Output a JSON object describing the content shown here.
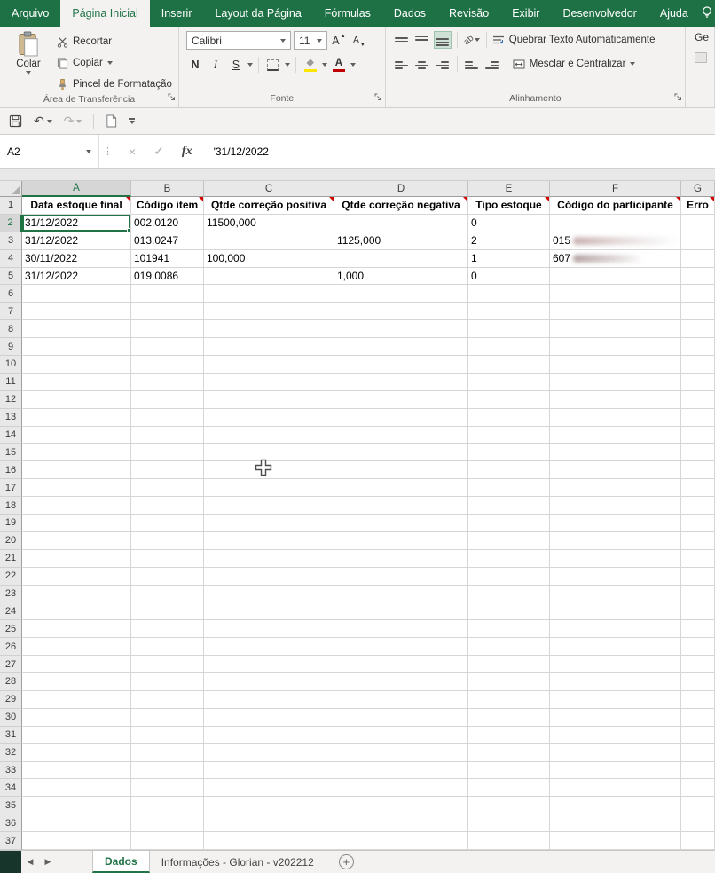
{
  "colors": {
    "accent_green": "#217346",
    "ribbon_green": "#1e7145",
    "ribbon_bg": "#f3f2f1",
    "grid_line": "#d6d6d6",
    "header_bg": "#e8e8e8",
    "selected_header_bg": "#d6d6d6",
    "comment_red": "#d40000",
    "fill_yellow": "#ffe600",
    "font_color_red": "#c00000"
  },
  "ribbon_tabs": [
    {
      "label": "Arquivo",
      "active": false
    },
    {
      "label": "Página Inicial",
      "active": true
    },
    {
      "label": "Inserir",
      "active": false
    },
    {
      "label": "Layout da Página",
      "active": false
    },
    {
      "label": "Fórmulas",
      "active": false
    },
    {
      "label": "Dados",
      "active": false
    },
    {
      "label": "Revisão",
      "active": false
    },
    {
      "label": "Exibir",
      "active": false
    },
    {
      "label": "Desenvolvedor",
      "active": false
    },
    {
      "label": "Ajuda",
      "active": false
    }
  ],
  "clipboard_group": {
    "paste": "Colar",
    "cut": "Recortar",
    "copy": "Copiar",
    "format_painter": "Pincel de Formatação",
    "label": "Área de Transferência"
  },
  "font_group": {
    "font_name": "Calibri",
    "font_size": "11",
    "bold": "N",
    "italic": "I",
    "underline": "S",
    "label": "Fonte"
  },
  "alignment_group": {
    "wrap_text": "Quebrar Texto Automaticamente",
    "merge_center": "Mesclar e Centralizar",
    "label": "Alinhamento"
  },
  "number_group_partial": "Ge",
  "formula_bar": {
    "name_box": "A2",
    "fx_label": "fx",
    "formula": "'31/12/2022"
  },
  "icons": {
    "cancel": "×",
    "enter": "✓",
    "undo": "↶",
    "redo": "↷",
    "nav_left": "◀",
    "nav_right": "▶",
    "plus": "+",
    "letter_a": "A",
    "tri_up": "▲",
    "tri_down": "▼",
    "orientation_ab": "ab",
    "merge_arrows": "↔",
    "more_vertical": "⋮"
  },
  "grid": {
    "col_letters": [
      "A",
      "B",
      "C",
      "D",
      "E",
      "F",
      "G"
    ],
    "row_count": 37,
    "header_row": [
      "Data estoque final",
      "Código item",
      "Qtde correção positiva",
      "Qtde correção negativa",
      "Tipo estoque",
      "Código do participante",
      "Erro"
    ],
    "data_rows": [
      {
        "row": 2,
        "values": [
          "31/12/2022",
          "002.0120",
          "11500,000",
          "",
          "0",
          "",
          ""
        ],
        "blur_col": -1
      },
      {
        "row": 3,
        "values": [
          "31/12/2022",
          "013.0247",
          "",
          "1125,000",
          "2",
          "015",
          ""
        ],
        "blur_col": 5
      },
      {
        "row": 4,
        "values": [
          "30/11/2022",
          "101941",
          "100,000",
          "",
          "1",
          "607",
          ""
        ],
        "blur_col": 5
      },
      {
        "row": 5,
        "values": [
          "31/12/2022",
          "019.0086",
          "",
          "1,000",
          "0",
          "",
          ""
        ],
        "blur_col": -1
      }
    ],
    "selected_cell": {
      "row": 2,
      "col": 0,
      "ref": "A2"
    }
  },
  "sheet_tabs": [
    {
      "label": "Dados",
      "active": true
    },
    {
      "label": "Informações - Glorian - v202212",
      "active": false
    }
  ]
}
